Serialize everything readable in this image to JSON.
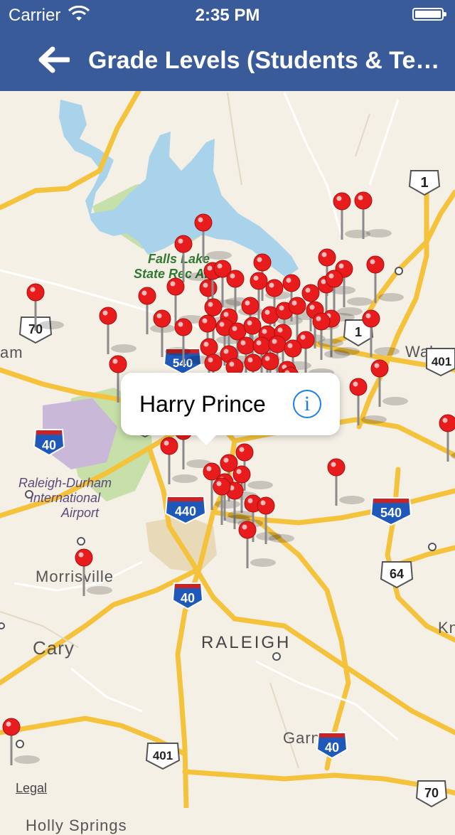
{
  "status_bar": {
    "carrier": "Carrier",
    "time": "2:35 PM",
    "battery_level": 1.0
  },
  "nav": {
    "title": "Grade Levels (Students & Teachers)",
    "back_icon": "arrow-left-icon"
  },
  "map": {
    "places": {
      "falls_lake_1": "Falls Lake",
      "falls_lake_2": "State Rec Area",
      "durham_partial": "am",
      "wake_partial": "Wake",
      "rdu_1": "Raleigh-Durham",
      "rdu_2": "International",
      "rdu_3": "Airport",
      "morrisville": "Morrisville",
      "cary": "Cary",
      "raleigh": "RALEIGH",
      "garner": "Garner",
      "holly_springs": "Holly Springs",
      "knightdale_partial": "Kn"
    },
    "shields": {
      "us1_top": "1",
      "us70_left": "70",
      "i540_top": "540",
      "us1_mid": "1",
      "us401_right": "401",
      "us70_mid": "70",
      "i40_left": "40",
      "i440": "440",
      "i540_right": "540",
      "us64": "64",
      "i40_center": "40",
      "us401_bottom": "401",
      "i40_bottom": "40",
      "us70_bottom": "70"
    },
    "colors": {
      "land": "#f5f0e6",
      "water": "#a9d3ea",
      "park": "#c7dfa8",
      "road": "#f5c23b",
      "interstate": "#1e58b8",
      "pin": "#e81c1c"
    }
  },
  "callout": {
    "title": "Harry Prince",
    "info_icon": "info-icon"
  },
  "legal": "Legal"
}
